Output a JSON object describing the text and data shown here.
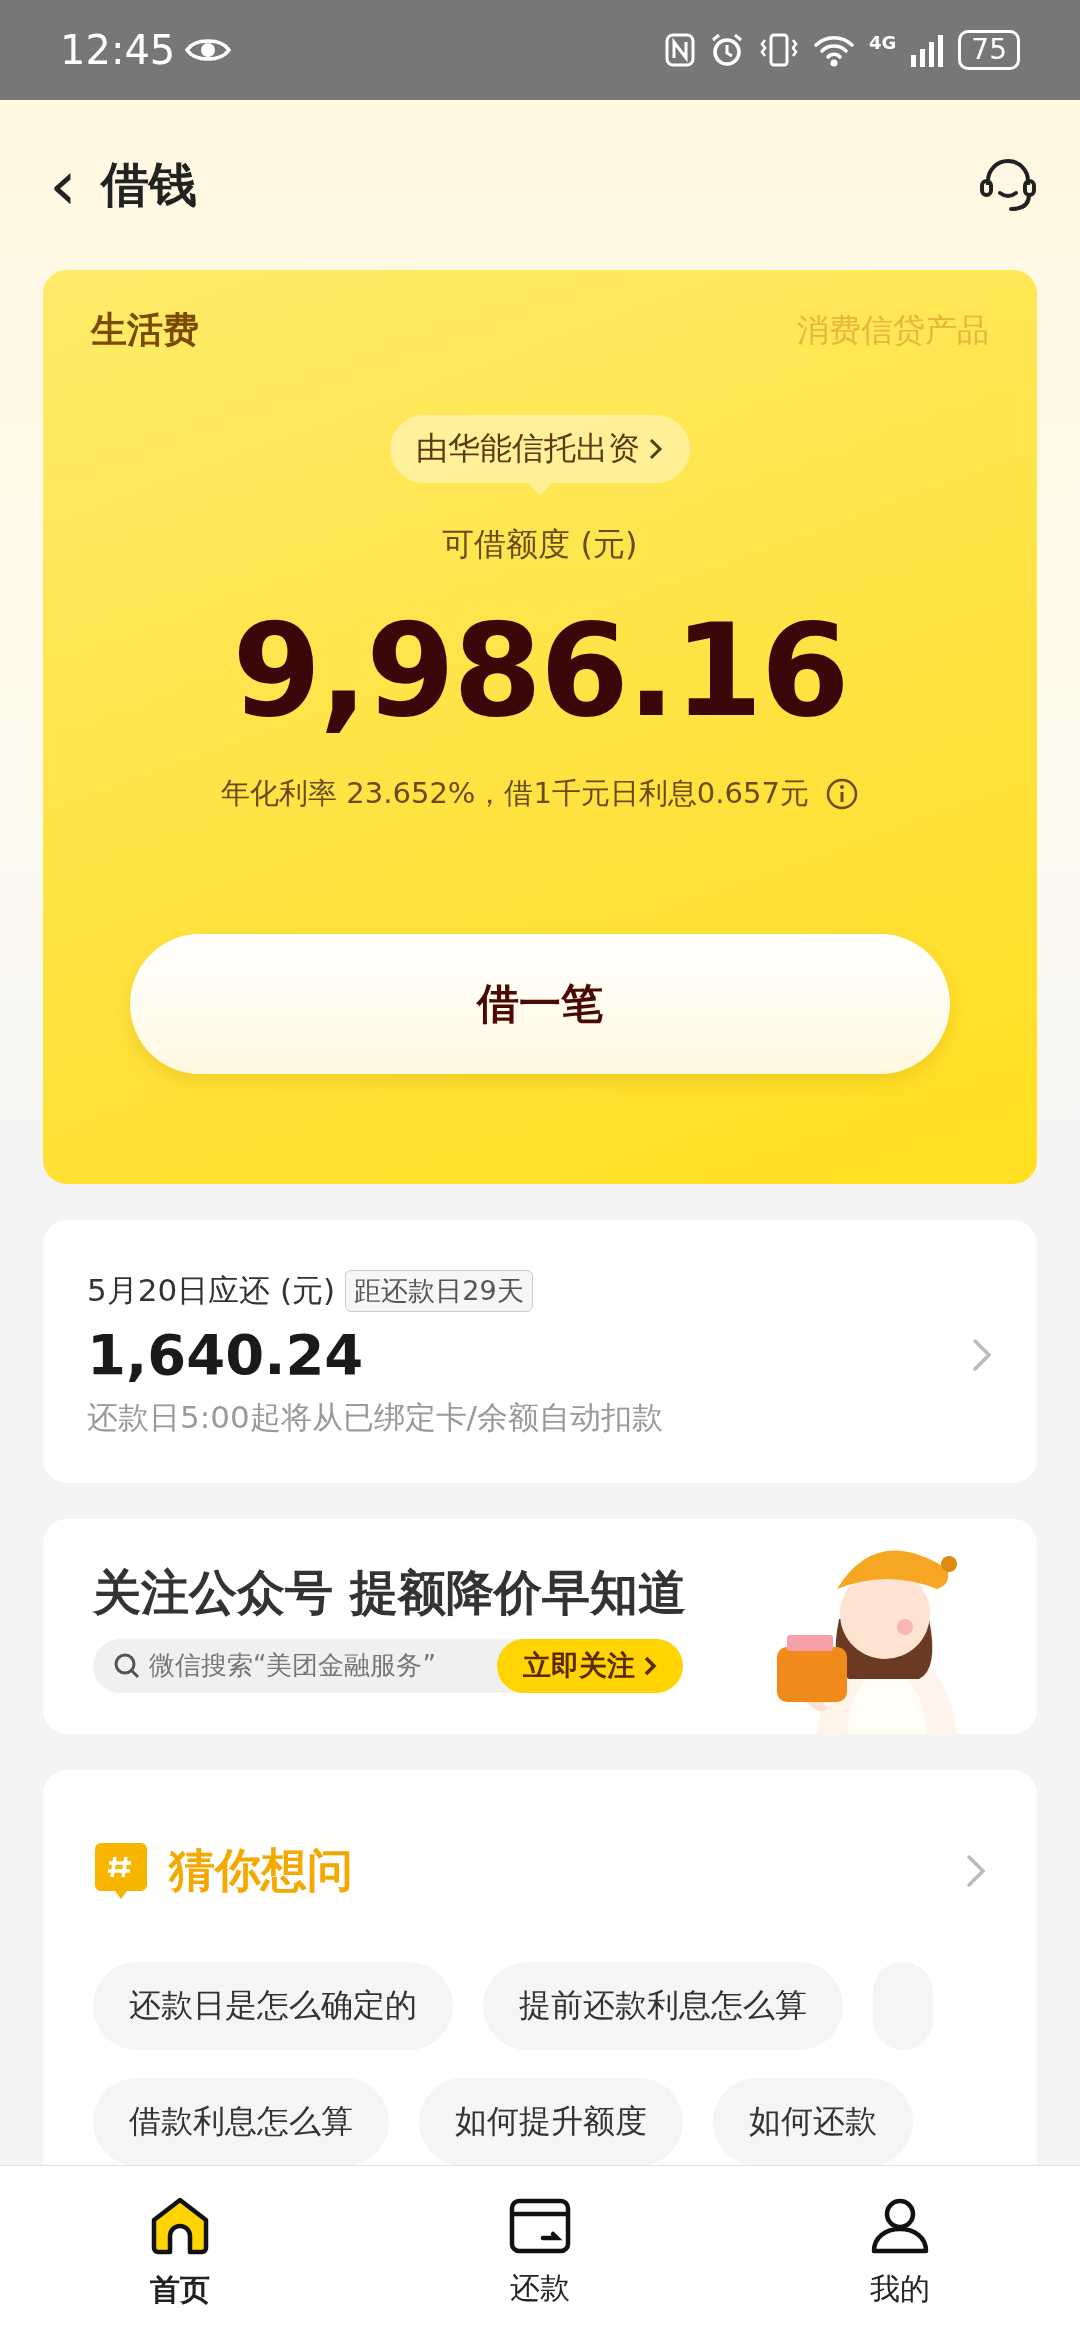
{
  "status_bar": {
    "time": "12:45",
    "battery": "75",
    "network": "4G"
  },
  "header": {
    "back": "‹",
    "title": "借钱"
  },
  "loan_card": {
    "product": "生活费",
    "category": "消费信贷产品",
    "funder": "由华能信托出资",
    "amount_label": "可借额度 (元)",
    "amount": "9,986.16",
    "rate_note": "年化利率 23.652%，借1千元日利息0.657元",
    "button": "借一笔"
  },
  "repay_card": {
    "label": "5月20日应还 (元)",
    "countdown": "距还款日29天",
    "amount": "1,640.24",
    "note": "还款日5:00起将从已绑定卡/余额自动扣款"
  },
  "banner": {
    "headline": "关注公众号 提额降价早知道",
    "search_hint": "微信搜索“美团金融服务”",
    "button": "立即关注"
  },
  "faq": {
    "title": "猜你想问",
    "rows": [
      [
        "还款日是怎么确定的",
        "提前还款利息怎么算"
      ],
      [
        "借款利息怎么算",
        "如何提升额度",
        "如何还款"
      ]
    ]
  },
  "tab_bar": [
    {
      "label": "首页",
      "kind": "home",
      "selected": true
    },
    {
      "label": "还款",
      "kind": "repay",
      "selected": false
    },
    {
      "label": "我的",
      "kind": "profile",
      "selected": false
    }
  ]
}
